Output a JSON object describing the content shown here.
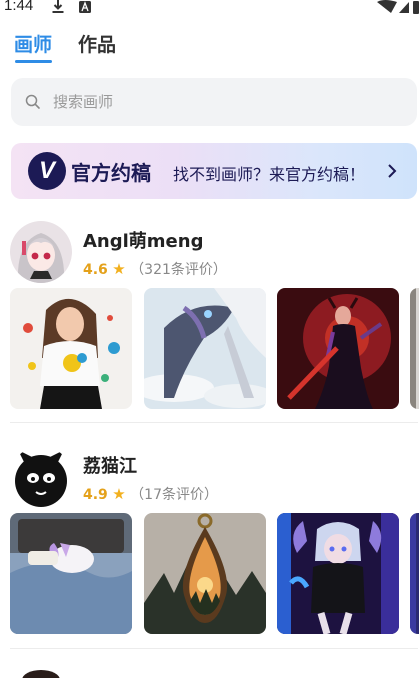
{
  "status_bar": {
    "time": "1:44"
  },
  "tabs": [
    {
      "label": "画师",
      "active": true
    },
    {
      "label": "作品",
      "active": false
    }
  ],
  "search": {
    "placeholder": "搜索画师",
    "value": ""
  },
  "banner": {
    "logo_letter": "V",
    "title": "官方约稿",
    "subtitle": "找不到画师？来官方约稿！",
    "colors": {
      "logo_bg": "#1c1a55",
      "text": "#1c1a55"
    }
  },
  "artists": [
    {
      "name": "Angl萌meng",
      "rating": "4.6",
      "star": "★",
      "review_count": "（321条评价）",
      "works": [
        "paint-splash-girl",
        "mecha-dragon",
        "red-demon-woman",
        "partial-artwork"
      ]
    },
    {
      "name": "荔猫江",
      "rating": "4.9",
      "star": "★",
      "review_count": "（17条评价）",
      "works": [
        "unicorn-in-bed",
        "forest-pendant",
        "neon-horned-girl",
        "partial-artwork"
      ]
    }
  ],
  "theme": {
    "accent": "#2e8ce6",
    "rating": "#e4a11a"
  }
}
